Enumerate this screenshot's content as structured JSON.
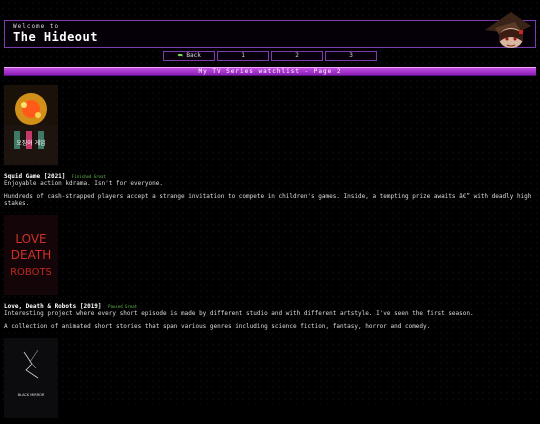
{
  "header": {
    "welcome": "Welcome to",
    "title": "The Hideout"
  },
  "nav": {
    "back_label": "Back",
    "pages": [
      "1",
      "2",
      "3"
    ]
  },
  "banner": {
    "text": "My TV Series watchlist - Page 2"
  },
  "entries": [
    {
      "title": "Squid Game [2021]",
      "status": "Finished   Great",
      "comment": "Enjoyable action kdrama. Isn't for everyone.",
      "description": "Hundreds of cash-strapped players accept a strange invitation to compete in children's games. Inside, a tempting prize awaits â€” with deadly high stakes.",
      "poster_text": "오징어 게임"
    },
    {
      "title": "Love, Death & Robots [2019]",
      "status": "Paused   Great",
      "comment": "Interesting project where every short episode is made by different studio and with different artstyle. I've seen the first season.",
      "description": "A collection of animated short stories that span various genres including science fiction, fantasy, horror and comedy.",
      "poster_text": "LOVE DEATH ROBOTS"
    },
    {
      "poster_text": "BLACK MIRROR"
    }
  ],
  "colors": {
    "accent": "#7d3bb0",
    "banner": "#b03ad6",
    "status": "#5fbf4a"
  }
}
